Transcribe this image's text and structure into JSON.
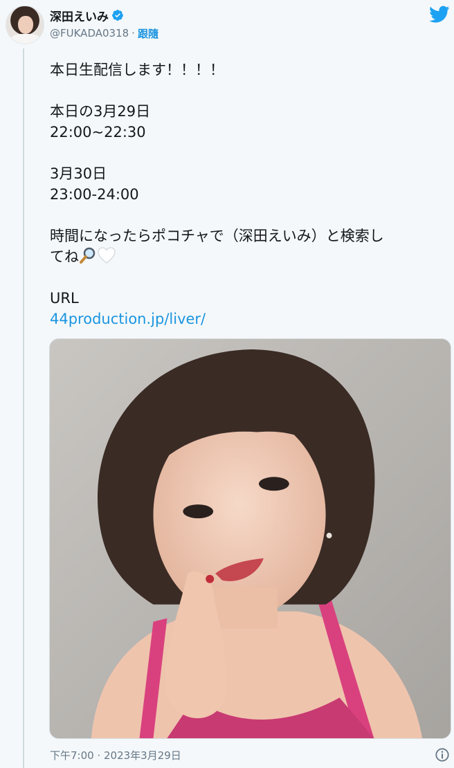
{
  "author": {
    "display_name": "深田えいみ",
    "handle": "@FUKADA0318",
    "separator": "·",
    "follow_label": "跟隨",
    "verified": true
  },
  "tweet": {
    "lines": [
      "本日生配信します！！！！",
      "",
      "本日の3月29日",
      "22:00~22:30",
      "",
      "3月30日",
      "23:00-24:00",
      "",
      "時間になったらポコチャで（深田えいみ）と検索し",
      "てね"
    ],
    "emojis": [
      "magnifying-glass-icon",
      "white-heart-icon"
    ],
    "url_label": "URL",
    "link_text": "44production.jp/liver/"
  },
  "media": {
    "type": "photo",
    "icon": "photo-icon"
  },
  "footer": {
    "timestamp": "下午7:00 · 2023年3月29日",
    "info_icon": "info-icon"
  },
  "colors": {
    "brand": "#1da1f2",
    "link": "#1b95e0",
    "muted": "#657786",
    "text": "#14171a",
    "background": "#f5f8fa"
  }
}
